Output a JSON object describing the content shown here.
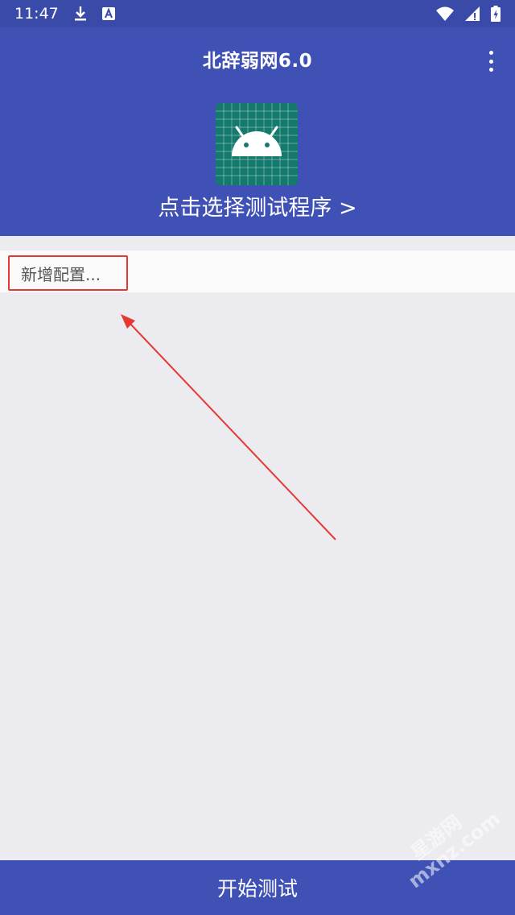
{
  "status_bar": {
    "time": "11:47",
    "icons": [
      "download-icon",
      "app-notification-icon",
      "wifi-icon",
      "cell-signal-icon",
      "battery-icon"
    ]
  },
  "app_bar": {
    "title": "北辞弱网6.0",
    "menu_icon": "more-vert-icon",
    "app_icon": "android-icon",
    "select_program_label": "点击选择测试程序 >"
  },
  "config_list": {
    "items": [
      {
        "label": "新增配置..."
      }
    ]
  },
  "bottom": {
    "start_label": "开始测试"
  },
  "watermark": {
    "line1": "星游网",
    "line2": "mxnz.com"
  },
  "colors": {
    "primary": "#3f51b5",
    "status_bar": "#3a4aa9",
    "background": "#ebebf0",
    "annotation": "#e53935",
    "icon_bg": "#157a6e"
  }
}
